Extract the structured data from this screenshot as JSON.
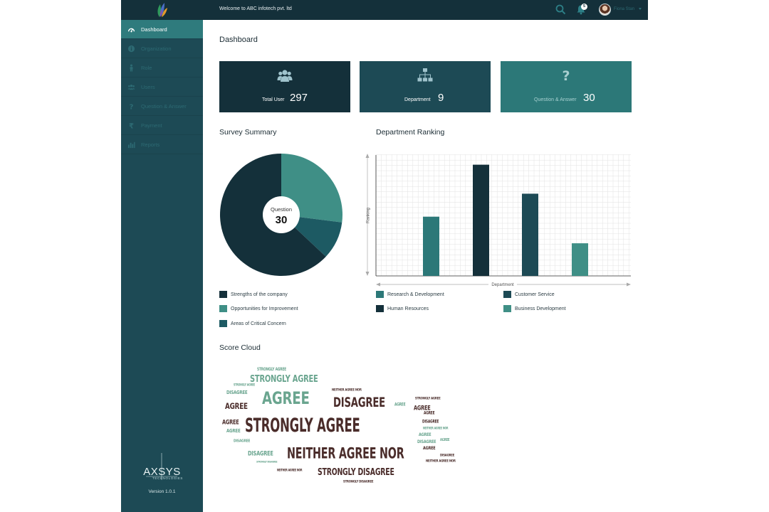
{
  "colors": {
    "navy": "#14303a",
    "teal_dark": "#1d4a55",
    "teal": "#2c7878",
    "green": "#3f8f86",
    "active": "#2f7b7d",
    "cloud_brown": "#4a2c2a",
    "cloud_green": "#6aa58f"
  },
  "topbar": {
    "welcome": "Welcome to ABC infotech pvt. ltd",
    "notification_count": "5",
    "username": "Fiona Stan"
  },
  "sidebar": {
    "items": [
      {
        "label": "Dashboard",
        "icon": "dashboard-icon",
        "active": true
      },
      {
        "label": "Organization",
        "icon": "info-icon"
      },
      {
        "label": "Role",
        "icon": "person-icon"
      },
      {
        "label": "Users",
        "icon": "users-icon"
      },
      {
        "label": "Question & Answer",
        "icon": "question-icon"
      },
      {
        "label": "Payment",
        "icon": "rupee-icon"
      },
      {
        "label": "Reports",
        "icon": "bar-chart-icon"
      }
    ],
    "brand": "AXSYS",
    "brand_sub": "TECHNOLOGIES",
    "version": "Version 1.0.1"
  },
  "page": {
    "title": "Dashboard"
  },
  "stats": [
    {
      "label": "Total User",
      "value": "297",
      "icon": "users-icon"
    },
    {
      "label": "Department",
      "value": "9",
      "icon": "org-chart-icon"
    },
    {
      "label": "Question & Answer",
      "value": "30",
      "icon": "question-icon"
    }
  ],
  "survey": {
    "title": "Survey Summary",
    "center_label": "Question",
    "center_value": "30"
  },
  "ranking": {
    "title": "Department Ranking"
  },
  "score_cloud": {
    "title": "Score Cloud",
    "words": [
      {
        "text": "STRONGLY AGREE",
        "color": "brown",
        "size": 30
      },
      {
        "text": "NEITHER AGREE NOR",
        "color": "brown",
        "size": 26
      },
      {
        "text": "AGREE",
        "color": "green",
        "size": 33
      },
      {
        "text": "DISAGREE",
        "color": "brown",
        "size": 24
      },
      {
        "text": "STRONGLY AGREE",
        "color": "green",
        "size": 18
      },
      {
        "text": "STRONGLY DISAGREE",
        "color": "brown",
        "size": 17
      },
      {
        "text": "AGREE",
        "color": "brown",
        "size": 16
      },
      {
        "text": "AGREE",
        "color": "brown",
        "size": 12
      },
      {
        "text": "DISAGREE",
        "color": "green",
        "size": 12
      },
      {
        "text": "DISAGREE",
        "color": "green",
        "size": 10
      },
      {
        "text": "AGREE",
        "color": "brown",
        "size": 12
      },
      {
        "text": "STRONGLY AGREE",
        "color": "green",
        "size": 8
      },
      {
        "text": "NEITHER AGREE NOR",
        "color": "brown",
        "size": 7
      },
      {
        "text": "AGREE",
        "color": "green",
        "size": 10
      },
      {
        "text": "DISAGREE",
        "color": "green",
        "size": 9
      },
      {
        "text": "NEITHER AGREE NOR",
        "color": "brown",
        "size": 6
      },
      {
        "text": "STRONGLY DISAGREE",
        "color": "brown",
        "size": 7
      },
      {
        "text": "AGREE",
        "color": "green",
        "size": 9
      },
      {
        "text": "DISAGREE",
        "color": "green",
        "size": 8
      },
      {
        "text": "STRONGLY AGREE",
        "color": "green",
        "size": 6
      },
      {
        "text": "AGREE",
        "color": "brown",
        "size": 8
      },
      {
        "text": "DISAGREE",
        "color": "brown",
        "size": 8
      },
      {
        "text": "NEITHER AGREE NOR",
        "color": "green",
        "size": 6
      },
      {
        "text": "AGREE",
        "color": "green",
        "size": 8
      },
      {
        "text": "STRONGLY DISAGREE",
        "color": "green",
        "size": 5
      },
      {
        "text": "AGREE",
        "color": "brown",
        "size": 9
      },
      {
        "text": "DISAGREE",
        "color": "brown",
        "size": 7
      },
      {
        "text": "NEITHER AGREE NOR",
        "color": "brown",
        "size": 7
      },
      {
        "text": "STRONGLY AGREE",
        "color": "brown",
        "size": 7
      },
      {
        "text": "AGREE",
        "color": "green",
        "size": 7
      }
    ]
  },
  "chart_data": [
    {
      "type": "pie",
      "title": "Survey Summary",
      "series": [
        {
          "name": "Strengths of the company",
          "value": 63,
          "color": "#14303a"
        },
        {
          "name": "Opportunities for Improvement",
          "value": 27,
          "color": "#3f8f86"
        },
        {
          "name": "Areas of Critical Concern",
          "value": 10,
          "color": "#1d5a63"
        }
      ],
      "legend_position": "bottom",
      "legend": [
        "Strengths of the company",
        "Opportunities for Improvement",
        "Areas of Critical Concern"
      ]
    },
    {
      "type": "bar",
      "title": "Department Ranking",
      "xlabel": "Department",
      "ylabel": "Ranking",
      "ylim": [
        0,
        100
      ],
      "grid": true,
      "legend_position": "bottom",
      "categories": [
        "Research & Development",
        "Human Resources",
        "Customer Service",
        "Business Development"
      ],
      "values": [
        49,
        92,
        68,
        27
      ],
      "colors": [
        "#2c7878",
        "#14303a",
        "#1d4a55",
        "#3f8f86"
      ]
    }
  ]
}
